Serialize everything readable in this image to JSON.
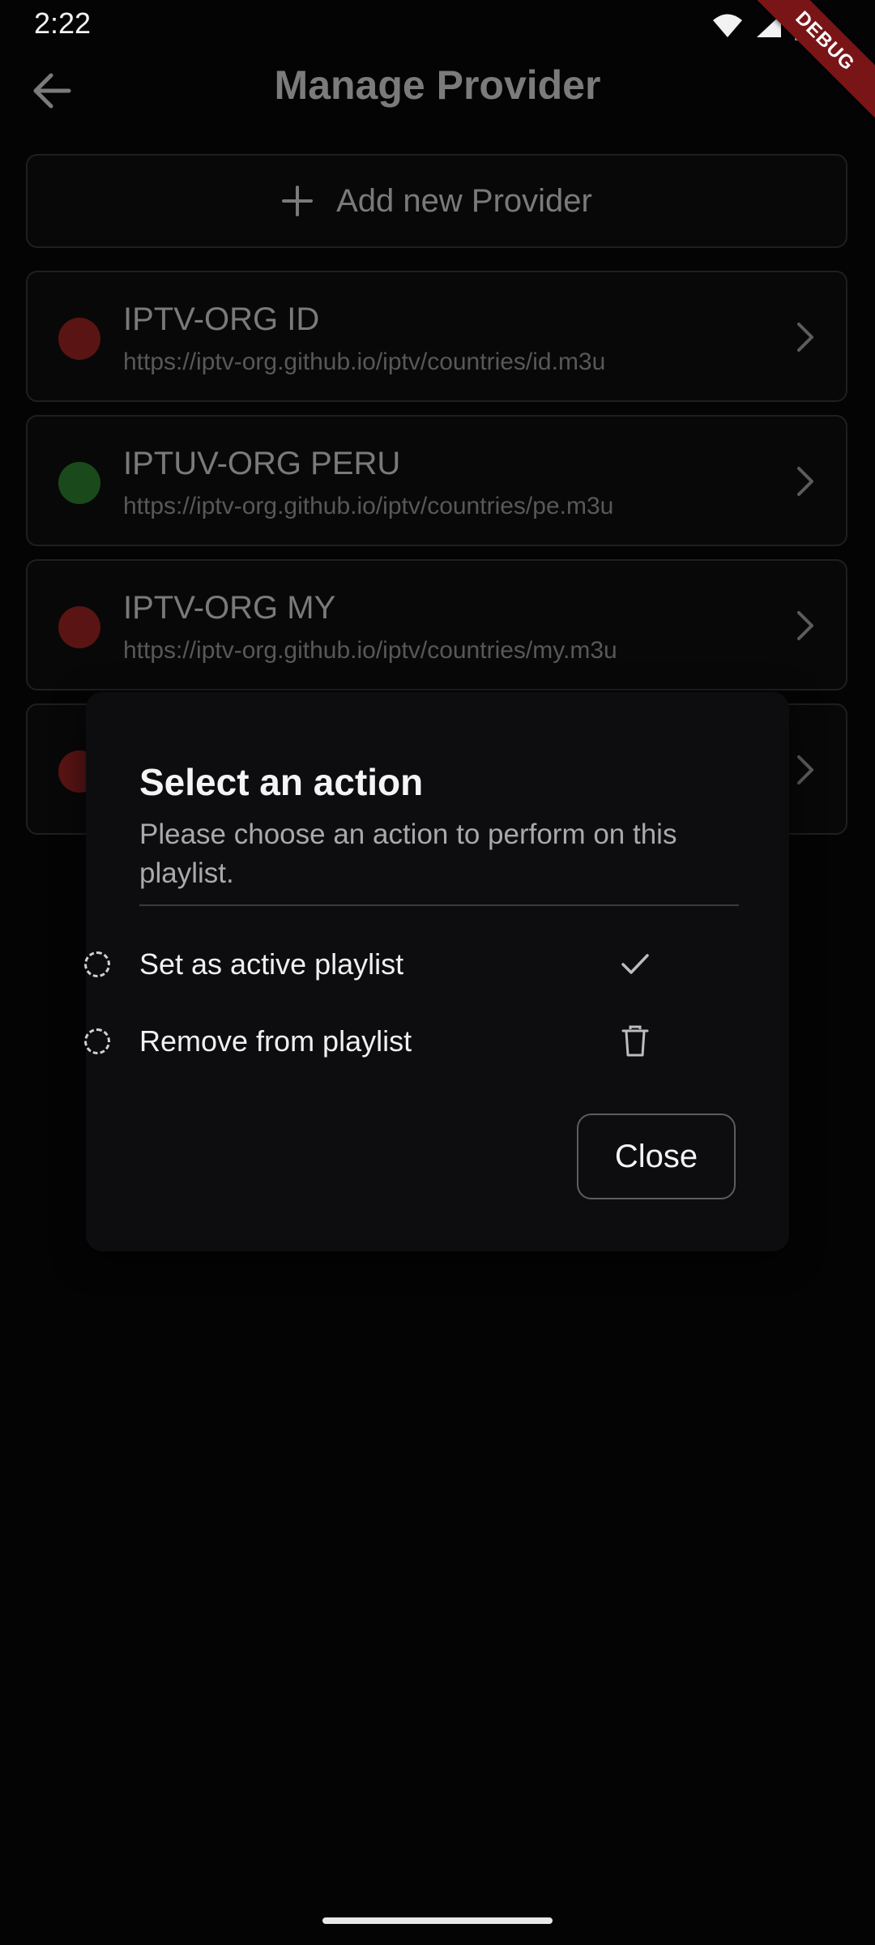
{
  "status_bar": {
    "time": "2:22",
    "icons": [
      "wifi-icon",
      "signal-icon",
      "battery-icon"
    ]
  },
  "debug_banner": "DEBUG",
  "app_bar": {
    "title": "Manage Provider",
    "back_icon": "arrow-left-icon"
  },
  "add_provider": {
    "label": "Add new Provider",
    "icon": "plus-icon"
  },
  "providers": [
    {
      "name": "IPTV-ORG ID",
      "url": "https://iptv-org.github.io/iptv/countries/id.m3u",
      "status_color": "#5a1414"
    },
    {
      "name": "IPTUV-ORG PERU",
      "url": "https://iptv-org.github.io/iptv/countries/pe.m3u",
      "status_color": "#1a4a1c"
    },
    {
      "name": "IPTV-ORG MY",
      "url": "https://iptv-org.github.io/iptv/countries/my.m3u",
      "status_color": "#5a1414"
    },
    {
      "name": "",
      "url": "",
      "status_color": "#5a1414"
    }
  ],
  "dialog": {
    "title": "Select an action",
    "message": "Please choose an action to perform on this playlist.",
    "options": [
      {
        "label": "Set as active playlist",
        "icon": "check-icon"
      },
      {
        "label": "Remove from playlist",
        "icon": "trash-icon"
      }
    ],
    "close_label": "Close"
  },
  "colors": {
    "background": "#040404",
    "dialog_bg": "#0d0d0f",
    "debug_ribbon": "#7a1517"
  }
}
